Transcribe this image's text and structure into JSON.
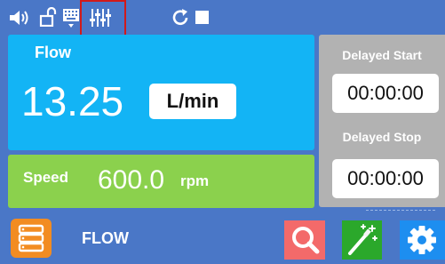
{
  "topbar": {
    "icons": [
      "speaker-icon",
      "unlock-icon",
      "keyboard-icon",
      "sliders-icon",
      "refresh-icon",
      "stop-icon"
    ]
  },
  "flow": {
    "title": "Flow",
    "value": "13.25",
    "unit": "L/min"
  },
  "speed": {
    "label": "Speed",
    "value": "600.0",
    "unit": "rpm"
  },
  "delays": {
    "start_label": "Delayed Start",
    "start_time": "00:00:00",
    "stop_label": "Delayed Stop",
    "stop_time": "00:00:00"
  },
  "bottombar": {
    "mode_label": "FLOW",
    "icons": [
      "menu-icon",
      "search-icon",
      "wand-icon",
      "gear-icon"
    ]
  },
  "colors": {
    "background": "#4a77c7",
    "flow_panel": "#13b4f5",
    "speed_panel": "#8bd14d",
    "delay_panel": "#b2b2b2",
    "menu_button": "#f28c22",
    "search_button": "#f36a6a",
    "wand_button": "#2ba82b",
    "gear_button": "#1d8ef0",
    "highlight": "#d11a1a"
  }
}
